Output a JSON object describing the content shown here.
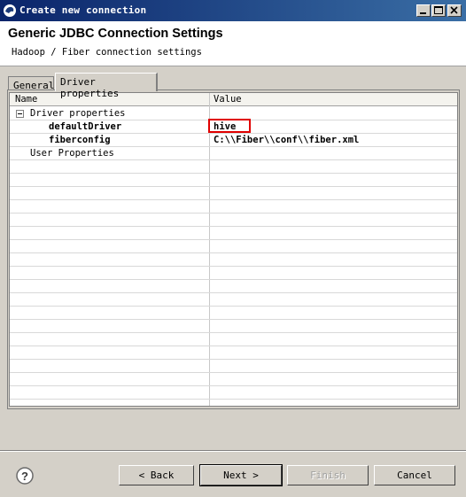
{
  "window": {
    "title": "Create new connection",
    "controls": [
      "minimize-icon",
      "maximize-icon",
      "close-icon"
    ]
  },
  "header": {
    "title": "Generic JDBC Connection Settings",
    "subtitle": "Hadoop / Fiber connection settings"
  },
  "tabs": [
    {
      "label": "General",
      "active": false
    },
    {
      "label": "Driver properties",
      "active": true
    }
  ],
  "table": {
    "columns": [
      "Name",
      "Value"
    ],
    "rows": [
      {
        "name": "Driver properties",
        "value": "",
        "expander": "minus",
        "bold": false
      },
      {
        "name": "defaultDriver",
        "value": "hive",
        "bold": true,
        "highlighted": true
      },
      {
        "name": "fiberconfig",
        "value": "C:\\\\Fiber\\\\conf\\\\fiber.xml",
        "bold": true
      },
      {
        "name": "User Properties",
        "value": "",
        "bold": false
      }
    ]
  },
  "buttons": {
    "back": "< Back",
    "next": "Next >",
    "finish": "Finish",
    "cancel": "Cancel"
  },
  "icons": {
    "help": "help-icon",
    "app": "app-icon"
  },
  "colors": {
    "highlight": "#e00000",
    "titlebar": "#0a246a"
  }
}
